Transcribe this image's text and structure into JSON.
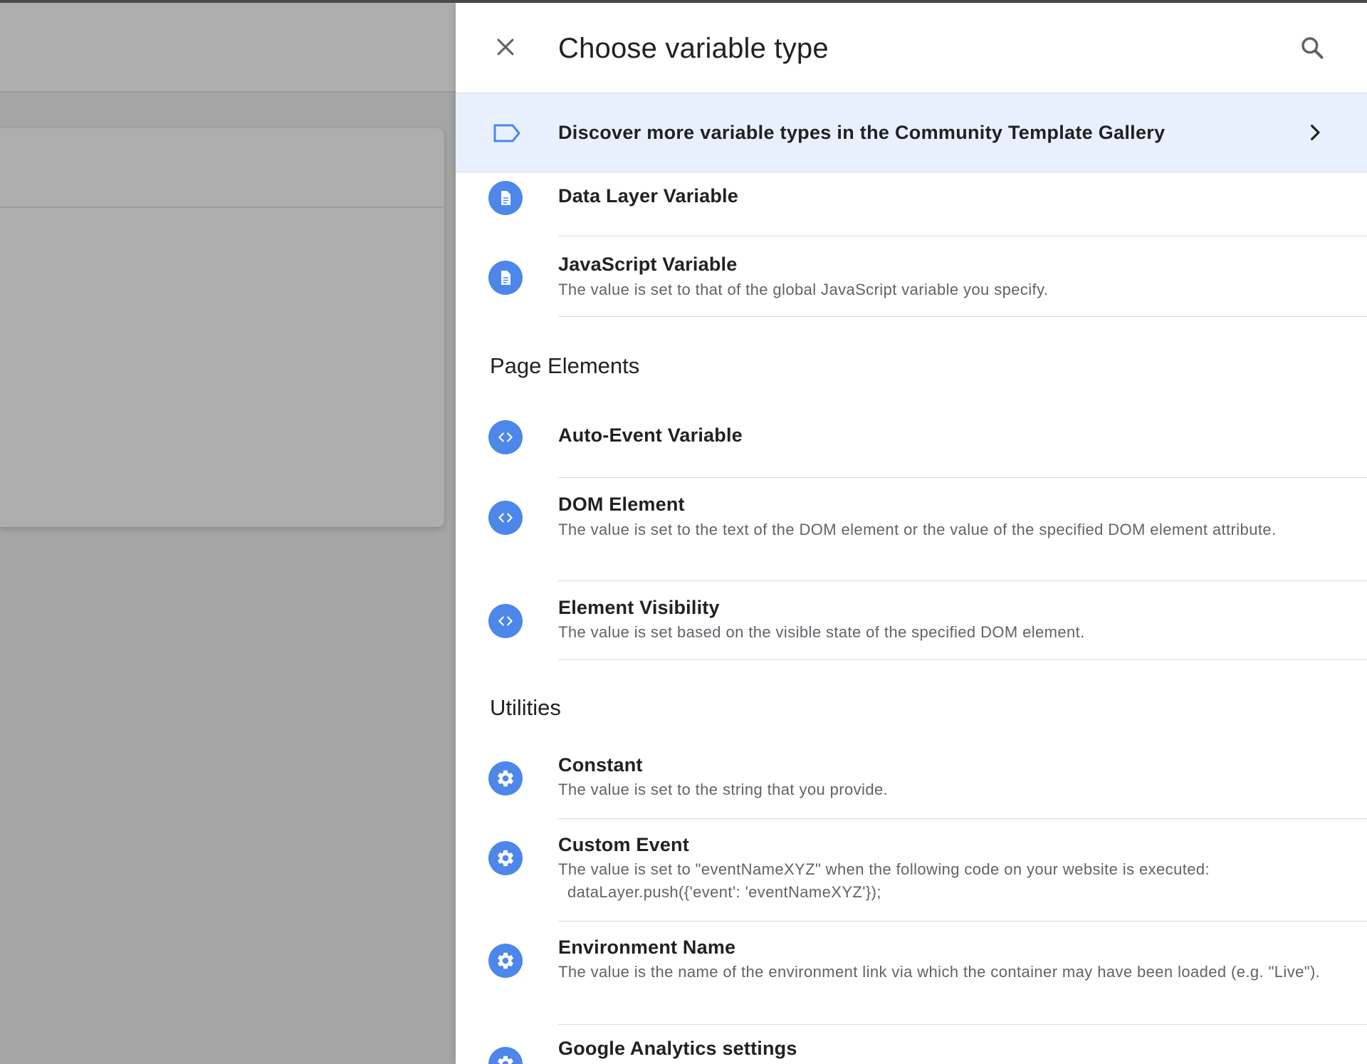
{
  "panel": {
    "title": "Choose variable type",
    "close_icon": "close-icon",
    "search_icon": "search-icon"
  },
  "gallery": {
    "text": "Discover more variable types in the Community Template Gallery",
    "icon": "label-tag-icon",
    "chevron": "chevron-right-icon",
    "background": "#e8f0fe"
  },
  "accent_color": "#4c87e9",
  "items": [
    {
      "title": "Data Layer Variable",
      "icon": "document-icon"
    },
    {
      "title": "JavaScript Variable",
      "description": "The value is set to that of the global JavaScript variable you specify.",
      "icon": "document-icon"
    },
    {
      "title": "Auto-Event Variable",
      "icon": "code-brackets-icon"
    },
    {
      "title": "DOM Element",
      "description": "The value is set to the text of the DOM element or the value of the specified DOM element attribute.",
      "icon": "code-brackets-icon"
    },
    {
      "title": "Element Visibility",
      "description": "The value is set based on the visible state of the specified DOM element.",
      "icon": "code-brackets-icon"
    },
    {
      "title": "Constant",
      "description": "The value is set to the string that you provide.",
      "icon": "gear-icon"
    },
    {
      "title": "Custom Event",
      "description": "The value is set to \"eventNameXYZ\" when the following code on your website is executed:",
      "code": "dataLayer.push({'event': 'eventNameXYZ'});",
      "icon": "gear-icon"
    },
    {
      "title": "Environment Name",
      "description": "The value is the name of the environment link via which the container may have been loaded (e.g. \"Live\").",
      "icon": "gear-icon"
    },
    {
      "title": "Google Analytics settings",
      "icon": "gear-icon"
    }
  ],
  "sections": {
    "page_elements": "Page Elements",
    "utilities": "Utilities"
  }
}
